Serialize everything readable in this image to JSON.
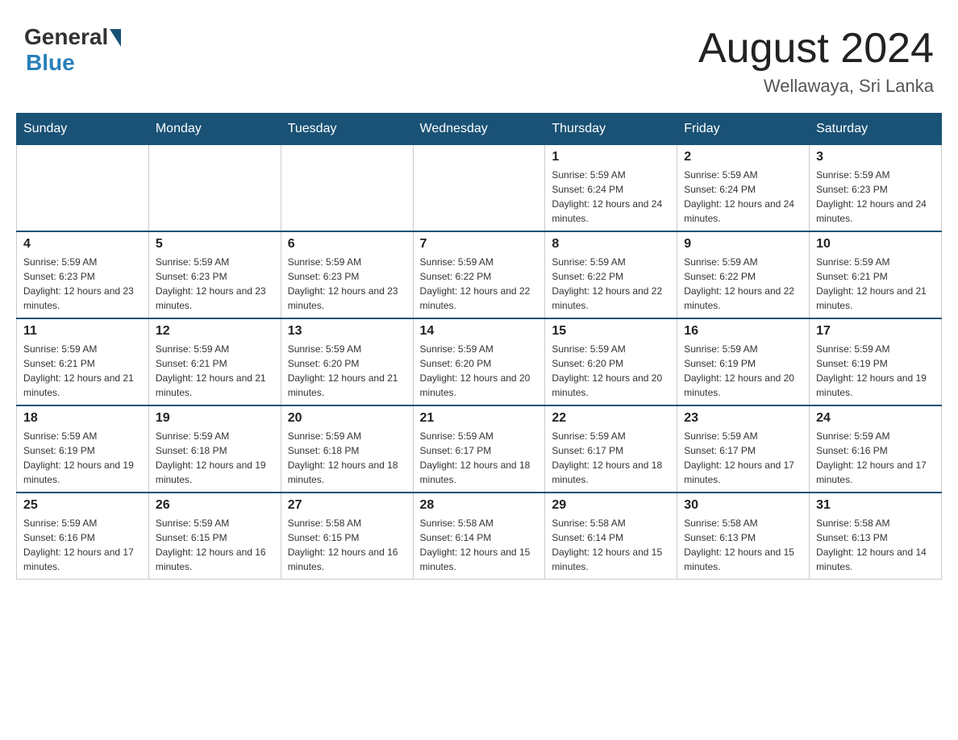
{
  "header": {
    "logo_general": "General",
    "logo_blue": "Blue",
    "month_title": "August 2024",
    "location": "Wellawaya, Sri Lanka"
  },
  "calendar": {
    "days_of_week": [
      "Sunday",
      "Monday",
      "Tuesday",
      "Wednesday",
      "Thursday",
      "Friday",
      "Saturday"
    ],
    "weeks": [
      [
        {
          "day": "",
          "info": ""
        },
        {
          "day": "",
          "info": ""
        },
        {
          "day": "",
          "info": ""
        },
        {
          "day": "",
          "info": ""
        },
        {
          "day": "1",
          "info": "Sunrise: 5:59 AM\nSunset: 6:24 PM\nDaylight: 12 hours and 24 minutes."
        },
        {
          "day": "2",
          "info": "Sunrise: 5:59 AM\nSunset: 6:24 PM\nDaylight: 12 hours and 24 minutes."
        },
        {
          "day": "3",
          "info": "Sunrise: 5:59 AM\nSunset: 6:23 PM\nDaylight: 12 hours and 24 minutes."
        }
      ],
      [
        {
          "day": "4",
          "info": "Sunrise: 5:59 AM\nSunset: 6:23 PM\nDaylight: 12 hours and 23 minutes."
        },
        {
          "day": "5",
          "info": "Sunrise: 5:59 AM\nSunset: 6:23 PM\nDaylight: 12 hours and 23 minutes."
        },
        {
          "day": "6",
          "info": "Sunrise: 5:59 AM\nSunset: 6:23 PM\nDaylight: 12 hours and 23 minutes."
        },
        {
          "day": "7",
          "info": "Sunrise: 5:59 AM\nSunset: 6:22 PM\nDaylight: 12 hours and 22 minutes."
        },
        {
          "day": "8",
          "info": "Sunrise: 5:59 AM\nSunset: 6:22 PM\nDaylight: 12 hours and 22 minutes."
        },
        {
          "day": "9",
          "info": "Sunrise: 5:59 AM\nSunset: 6:22 PM\nDaylight: 12 hours and 22 minutes."
        },
        {
          "day": "10",
          "info": "Sunrise: 5:59 AM\nSunset: 6:21 PM\nDaylight: 12 hours and 21 minutes."
        }
      ],
      [
        {
          "day": "11",
          "info": "Sunrise: 5:59 AM\nSunset: 6:21 PM\nDaylight: 12 hours and 21 minutes."
        },
        {
          "day": "12",
          "info": "Sunrise: 5:59 AM\nSunset: 6:21 PM\nDaylight: 12 hours and 21 minutes."
        },
        {
          "day": "13",
          "info": "Sunrise: 5:59 AM\nSunset: 6:20 PM\nDaylight: 12 hours and 21 minutes."
        },
        {
          "day": "14",
          "info": "Sunrise: 5:59 AM\nSunset: 6:20 PM\nDaylight: 12 hours and 20 minutes."
        },
        {
          "day": "15",
          "info": "Sunrise: 5:59 AM\nSunset: 6:20 PM\nDaylight: 12 hours and 20 minutes."
        },
        {
          "day": "16",
          "info": "Sunrise: 5:59 AM\nSunset: 6:19 PM\nDaylight: 12 hours and 20 minutes."
        },
        {
          "day": "17",
          "info": "Sunrise: 5:59 AM\nSunset: 6:19 PM\nDaylight: 12 hours and 19 minutes."
        }
      ],
      [
        {
          "day": "18",
          "info": "Sunrise: 5:59 AM\nSunset: 6:19 PM\nDaylight: 12 hours and 19 minutes."
        },
        {
          "day": "19",
          "info": "Sunrise: 5:59 AM\nSunset: 6:18 PM\nDaylight: 12 hours and 19 minutes."
        },
        {
          "day": "20",
          "info": "Sunrise: 5:59 AM\nSunset: 6:18 PM\nDaylight: 12 hours and 18 minutes."
        },
        {
          "day": "21",
          "info": "Sunrise: 5:59 AM\nSunset: 6:17 PM\nDaylight: 12 hours and 18 minutes."
        },
        {
          "day": "22",
          "info": "Sunrise: 5:59 AM\nSunset: 6:17 PM\nDaylight: 12 hours and 18 minutes."
        },
        {
          "day": "23",
          "info": "Sunrise: 5:59 AM\nSunset: 6:17 PM\nDaylight: 12 hours and 17 minutes."
        },
        {
          "day": "24",
          "info": "Sunrise: 5:59 AM\nSunset: 6:16 PM\nDaylight: 12 hours and 17 minutes."
        }
      ],
      [
        {
          "day": "25",
          "info": "Sunrise: 5:59 AM\nSunset: 6:16 PM\nDaylight: 12 hours and 17 minutes."
        },
        {
          "day": "26",
          "info": "Sunrise: 5:59 AM\nSunset: 6:15 PM\nDaylight: 12 hours and 16 minutes."
        },
        {
          "day": "27",
          "info": "Sunrise: 5:58 AM\nSunset: 6:15 PM\nDaylight: 12 hours and 16 minutes."
        },
        {
          "day": "28",
          "info": "Sunrise: 5:58 AM\nSunset: 6:14 PM\nDaylight: 12 hours and 15 minutes."
        },
        {
          "day": "29",
          "info": "Sunrise: 5:58 AM\nSunset: 6:14 PM\nDaylight: 12 hours and 15 minutes."
        },
        {
          "day": "30",
          "info": "Sunrise: 5:58 AM\nSunset: 6:13 PM\nDaylight: 12 hours and 15 minutes."
        },
        {
          "day": "31",
          "info": "Sunrise: 5:58 AM\nSunset: 6:13 PM\nDaylight: 12 hours and 14 minutes."
        }
      ]
    ]
  }
}
